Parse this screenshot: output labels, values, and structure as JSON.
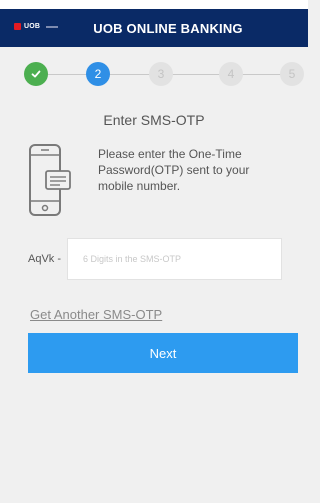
{
  "header": {
    "logo_text": "UOB",
    "title": "UOB ONLINE BANKING"
  },
  "steps": [
    {
      "label": "",
      "state": "done",
      "icon": "check-icon"
    },
    {
      "label": "2",
      "state": "active"
    },
    {
      "label": "3",
      "state": "todo"
    },
    {
      "label": "4",
      "state": "todo"
    },
    {
      "label": "5",
      "state": "todo"
    }
  ],
  "content": {
    "section_title": "Enter SMS-OTP",
    "instruction": "Please enter the One-Time Password(OTP) sent to your mobile number.",
    "phone_icon": "phone-sms-icon"
  },
  "otp": {
    "prefix": "AqVk -",
    "value": "",
    "placeholder": "6 Digits in the SMS-OTP"
  },
  "links": {
    "resend_label": "Get Another SMS-OTP"
  },
  "actions": {
    "next_label": "Next"
  },
  "colors": {
    "header_bg": "#0a2a66",
    "step_done": "#4caf50",
    "step_active": "#2f8fe6",
    "button": "#2d9bf0",
    "logo_red": "#e31b23"
  }
}
